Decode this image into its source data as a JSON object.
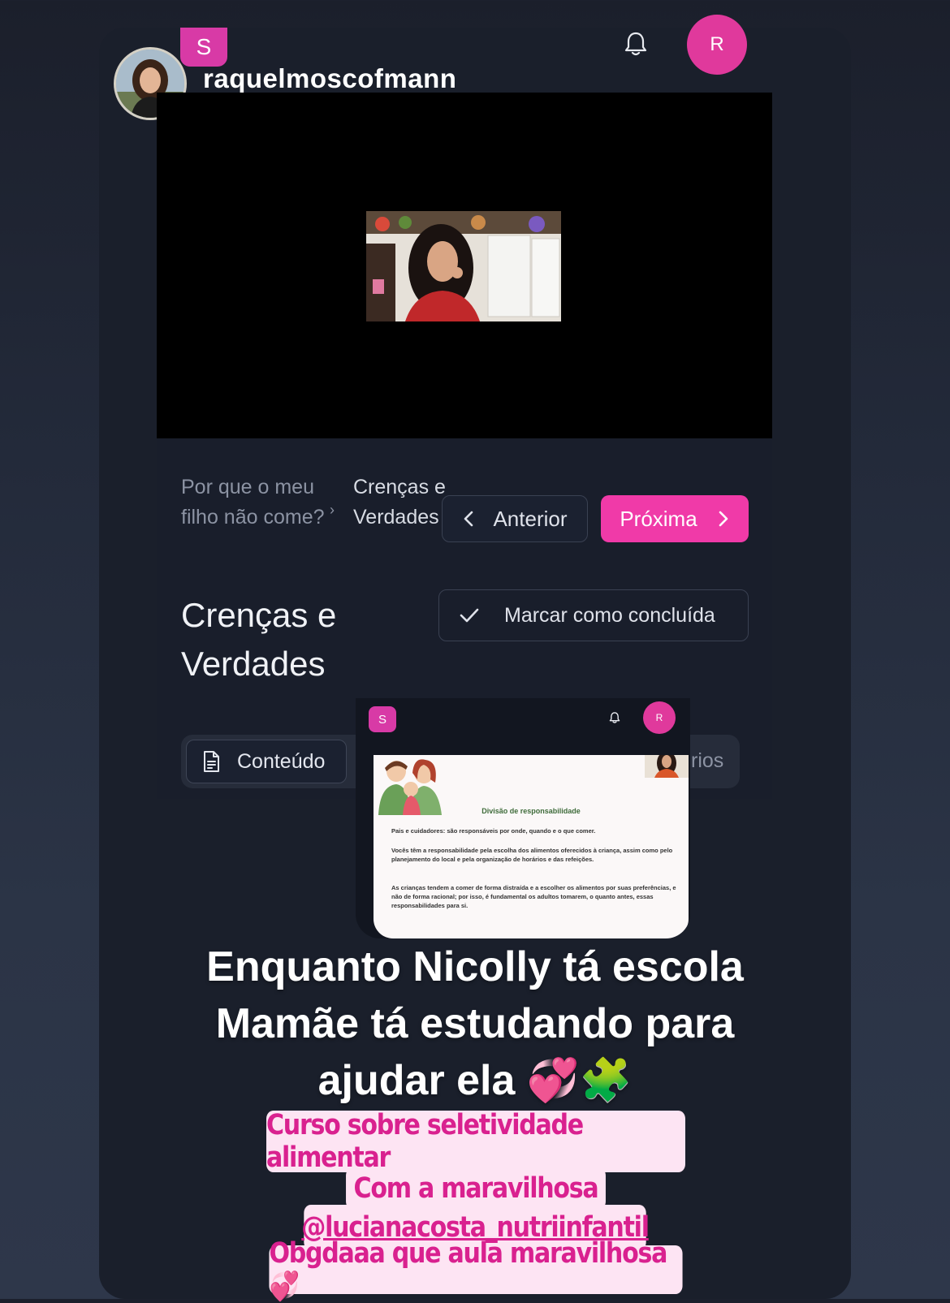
{
  "story": {
    "username": "raquelmoscofmann"
  },
  "app": {
    "logo_letter": "S",
    "avatar_letter": "R",
    "bell_icon": "bell-icon"
  },
  "breadcrumb": {
    "course": "Por que o meu filho não come?",
    "separator": "›",
    "lesson": "Crenças e Verdades"
  },
  "nav": {
    "prev_label": "Anterior",
    "next_label": "Próxima"
  },
  "lesson": {
    "title": "Crenças e Verdades",
    "complete_label": "Marcar como concluída"
  },
  "tabs": {
    "content_label": "Conteúdo",
    "other_label_visible": "rios"
  },
  "slide": {
    "title": "Divisão de responsabilidade",
    "line1": "Pais e cuidadores: são responsáveis por onde, quando e o que comer.",
    "line2": "Vocês têm a responsabilidade pela escolha dos alimentos oferecidos à criança, assim como pelo planejamento do local e pela organização de horários e das refeições.",
    "line3": "As crianças tendem a comer de forma distraída e a escolher os alimentos por suas preferências, e não de forma racional; por isso, é fundamental os adultos tomarem, o quanto antes, essas responsabilidades para si."
  },
  "caption": {
    "line1": "Enquanto Nicolly tá escola",
    "line2": "Mamãe tá estudando para",
    "line3": "ajudar ela 💞🧩"
  },
  "sticker": {
    "line1": "Curso sobre seletividade alimentar",
    "line2": "Com a maravilhosa",
    "line3": "@lucianacosta_nutriinfantil",
    "line4": "Obgdaaa que aula maravilhosa 💞"
  },
  "colors": {
    "accent": "#f03aa8",
    "panel": "#191e2b",
    "sticker_bg": "#fde4f3",
    "sticker_text": "#d9218f"
  }
}
